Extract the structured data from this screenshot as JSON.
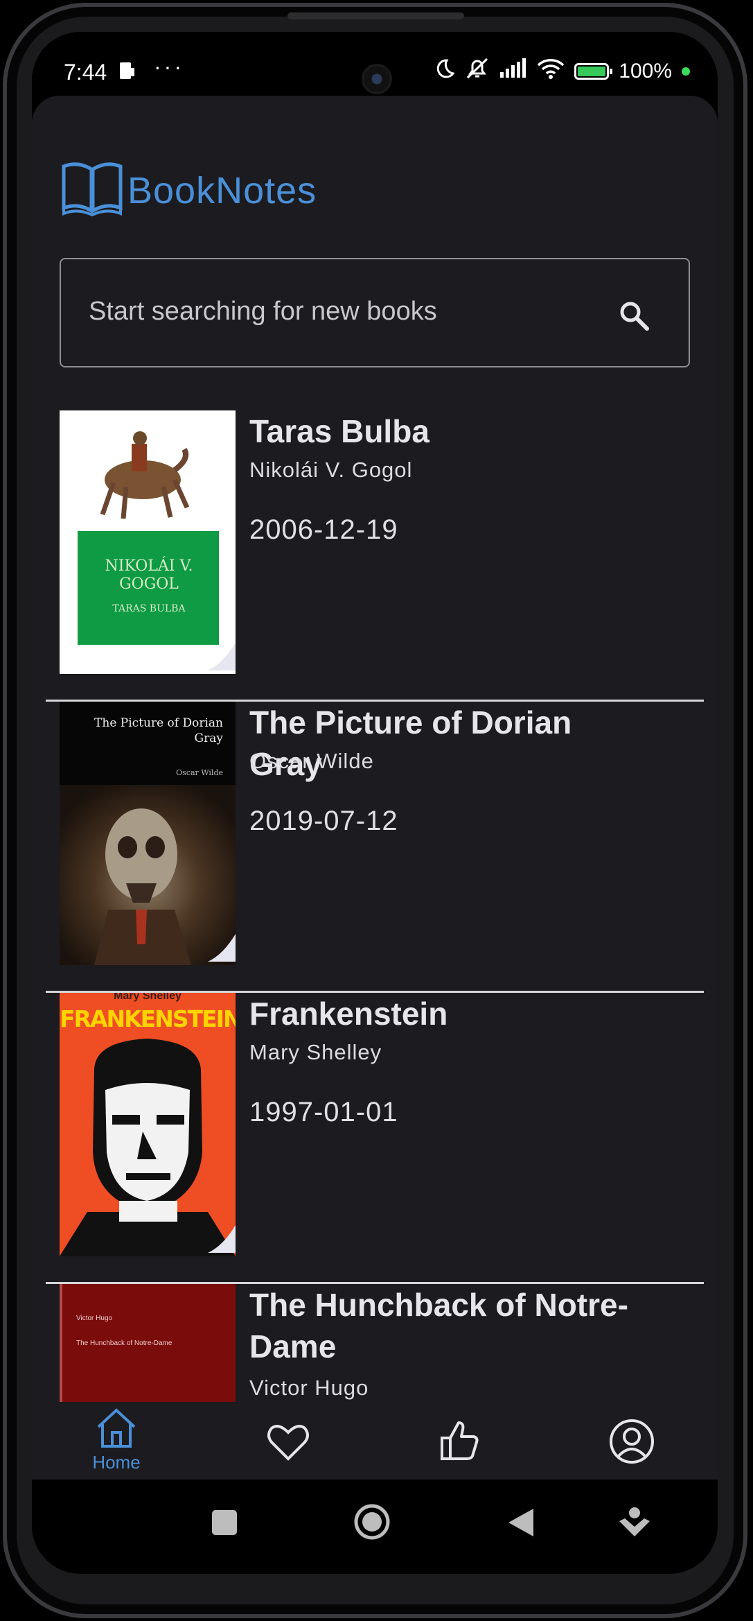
{
  "status_bar": {
    "time": "7:44",
    "more": "···",
    "battery": "100%"
  },
  "app": {
    "name": "BookNotes"
  },
  "search": {
    "placeholder": "Start searching for new books"
  },
  "books": [
    {
      "title": "Taras Bulba",
      "author": "Nikolái V. Gogol",
      "date": "2006-12-19",
      "cover": {
        "top_text": "",
        "main_text": "NIKOLÁI V. GOGOL",
        "sub_text": "TARAS BULBA"
      }
    },
    {
      "title": "The Picture of Dorian Gray",
      "author": "Oscar Wilde",
      "date": "2019-07-12",
      "cover": {
        "top_text": "The Picture of Dorian Gray",
        "sub_text": "Oscar Wilde"
      }
    },
    {
      "title": "Frankenstein",
      "author": "Mary Shelley",
      "date": "1997-01-01",
      "cover": {
        "top_text": "Mary Shelley",
        "main_text": "FRANKENSTEIN"
      }
    },
    {
      "title": "The Hunchback of Notre-Dame",
      "author": "Victor Hugo",
      "date": "",
      "cover": {
        "top_text": "Victor Hugo",
        "main_text": "The Hunchback of Notre-Dame"
      }
    }
  ],
  "nav": {
    "home_label": "Home",
    "active": "home",
    "accent": "#4a90d9"
  },
  "colors": {
    "background": "#1c1b1f",
    "accent": "#4a90d9",
    "divider": "#d6d6d8"
  }
}
